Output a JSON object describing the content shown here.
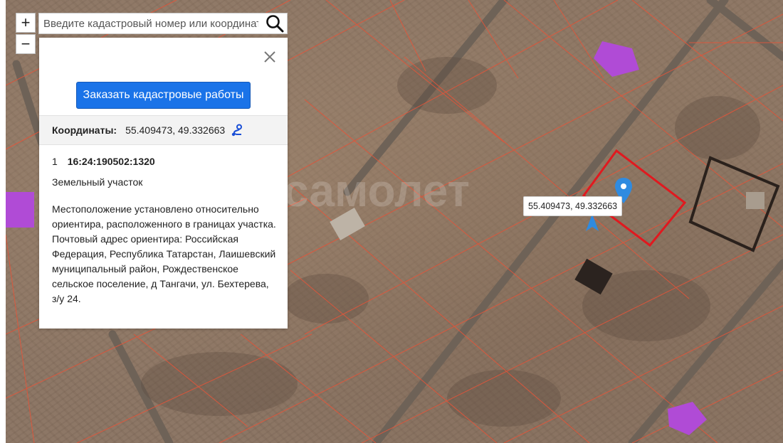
{
  "map_controls": {
    "zoom_in": "+",
    "zoom_out": "−"
  },
  "search": {
    "placeholder": "Введите кадастровый номер или координаты",
    "icon": "search-icon"
  },
  "info_panel": {
    "close_icon": "close-icon",
    "order_button": "Заказать кадастровые работы",
    "coords_label": "Координаты:",
    "coords_value": "55.409473, 49.332663",
    "route_icon": "route-icon",
    "parcel_number": "1",
    "parcel_id": "16:24:190502:1320",
    "parcel_type": "Земельный участок",
    "parcel_description": "Местоположение установлено относительно ориентира, расположенного в границах участка. Почтовый адрес ориентира: Российская Федерация, Республика Татарстан, Лаишевский муниципальный район, Рождественское сельское поселение, д Тангачи, ул. Бехтерева, з/у 24."
  },
  "map": {
    "tooltip": "55.409473, 49.332663",
    "colors": {
      "parcel_border": "#e2553a",
      "selected_parcel": "#e0191f",
      "pin": "#2f8be0",
      "roof": "#b04bd6",
      "button": "#1a73e8"
    }
  }
}
